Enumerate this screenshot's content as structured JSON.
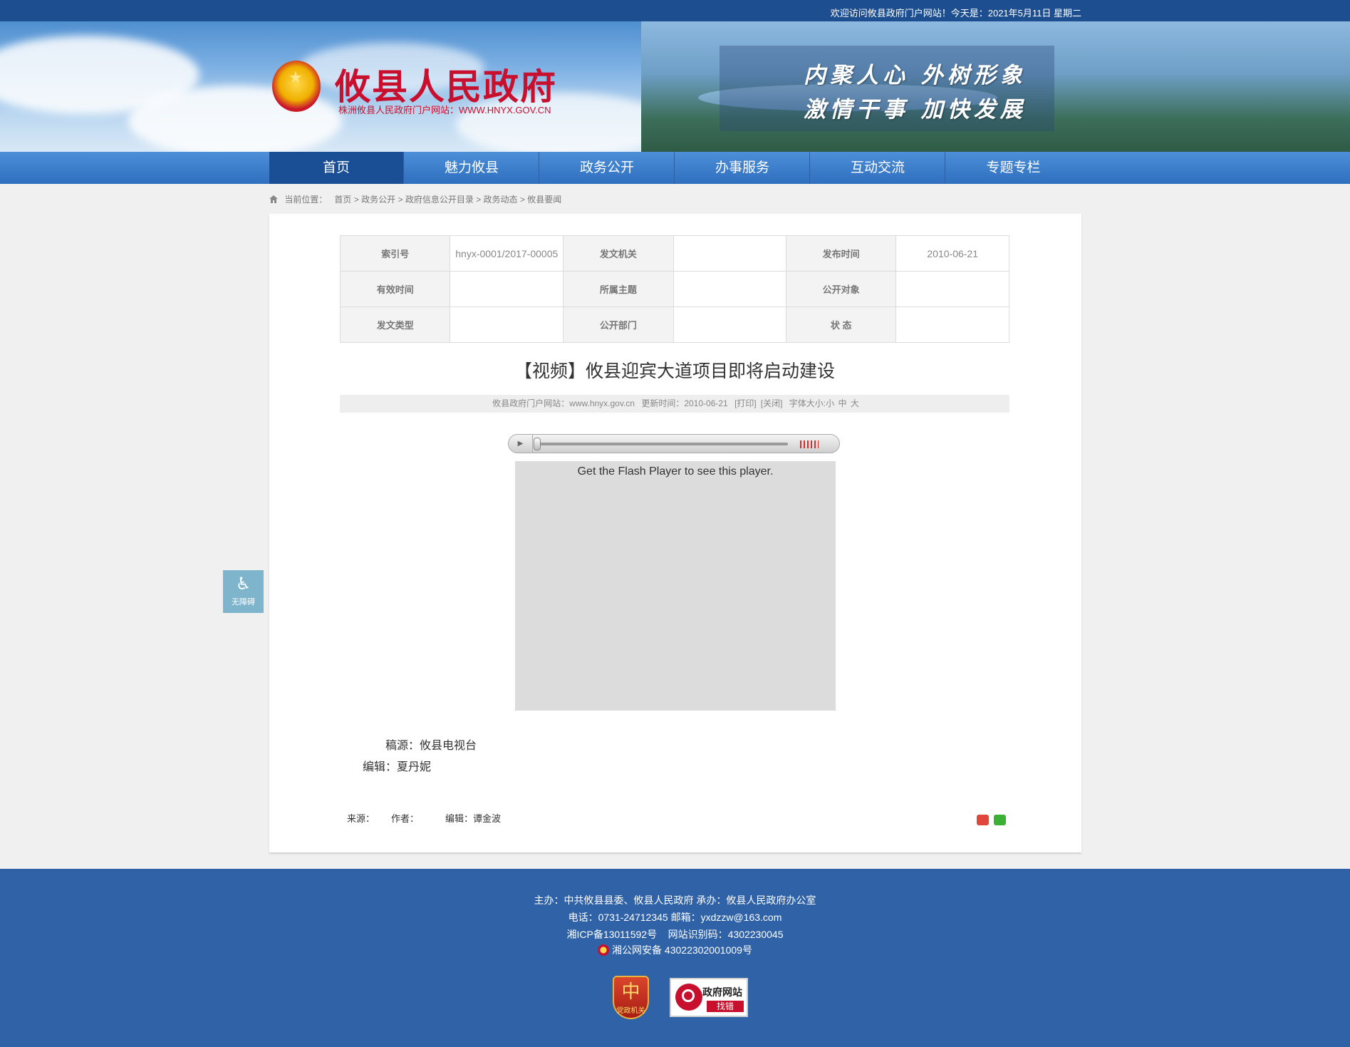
{
  "topbar": {
    "text": "欢迎访问攸县政府门户网站！今天是：2021年5月11日 星期二"
  },
  "header": {
    "site_title": "攸县人民政府",
    "site_subtitle": "株洲攸县人民政府门户网站：WWW.HNYX.GOV.CN",
    "slogan_line1": "内聚人心 外树形象",
    "slogan_line2": "激情干事 加快发展"
  },
  "nav": {
    "items": [
      {
        "label": "首页"
      },
      {
        "label": "魅力攸县"
      },
      {
        "label": "政务公开"
      },
      {
        "label": "办事服务"
      },
      {
        "label": "互动交流"
      },
      {
        "label": "专题专栏"
      }
    ]
  },
  "breadcrumb": {
    "prefix": "当前位置：",
    "items": [
      "首页",
      "政务公开",
      "政府信息公开目录",
      "政务动态",
      "攸县要闻"
    ],
    "separator": ">"
  },
  "meta_table": {
    "rows": [
      [
        {
          "k": "索引号",
          "v": "hnyx-0001/2017-00005"
        },
        {
          "k": "发文机关",
          "v": ""
        },
        {
          "k": "发布时间",
          "v": "2010-06-21"
        }
      ],
      [
        {
          "k": "有效时间",
          "v": ""
        },
        {
          "k": "所属主题",
          "v": ""
        },
        {
          "k": "公开对象",
          "v": ""
        }
      ],
      [
        {
          "k": "发文类型",
          "v": ""
        },
        {
          "k": "公开部门",
          "v": ""
        },
        {
          "k": "状 态",
          "v": ""
        }
      ]
    ]
  },
  "article": {
    "title": "【视频】攸县迎宾大道项目即将启动建设",
    "info": {
      "site": "攸县政府门户网站：www.hnyx.gov.cn",
      "updated": "更新时间：2010-06-21",
      "print": "[打印]",
      "close": "[关闭]",
      "font_size_label": "字体大小:",
      "font_small": "小",
      "font_medium": "中",
      "font_large": "大"
    },
    "player": {
      "play_icon": "play-icon",
      "flash_message": "Get the Flash Player to see this player."
    },
    "source_line": "稿源：攸县电视台",
    "editor_line": "编辑：夏丹妮",
    "footer_meta": {
      "source": "来源：",
      "author": "作者：",
      "editor": "编辑：谭金波"
    },
    "share": {
      "weibo_icon": "weibo-icon",
      "wechat_icon": "wechat-icon"
    }
  },
  "a11y": {
    "label": "无障碍"
  },
  "footer": {
    "line1": "主办：中共攸县县委、攸县人民政府 承办：攸县人民政府办公室",
    "line2": "电话：0731-24712345 邮箱：yxdzzw@163.com",
    "line3": "湘ICP备13011592号    网站识别码：4302230045",
    "line4": "湘公网安备 43022302001009号",
    "badge1_text": "党政机关",
    "badge2_title": "政府网站",
    "badge2_sub": "找错"
  },
  "colors": {
    "top": "#1d4e8f",
    "nav": "#2f6fbf",
    "nav_active": "#1a4f95",
    "footer": "#2f62a7",
    "brand_red": "#c8102e"
  }
}
